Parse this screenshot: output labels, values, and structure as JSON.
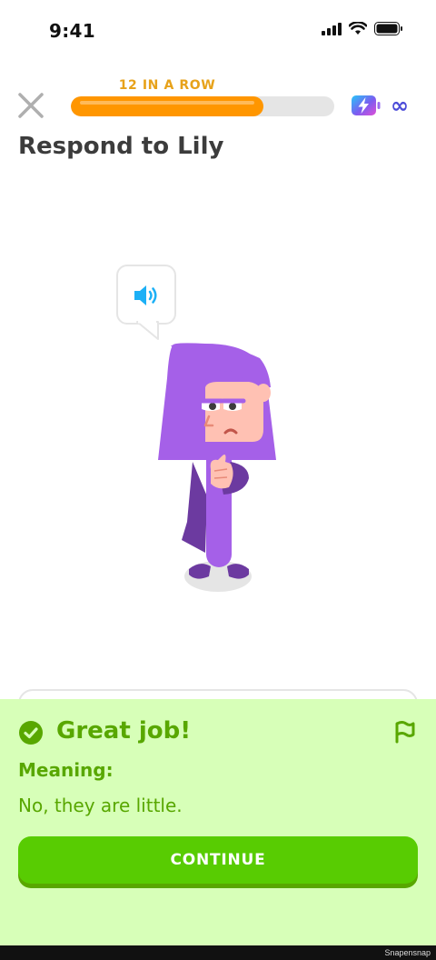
{
  "status_bar": {
    "time": "9:41"
  },
  "header": {
    "streak_label": "12 IN A ROW",
    "progress_fraction": 0.73,
    "energy_value": "∞"
  },
  "prompt": {
    "title": "Respond to Lily"
  },
  "feedback": {
    "title": "Great job!",
    "meaning_label": "Meaning:",
    "meaning_text": "No, they are little.",
    "continue_label": "CONTINUE"
  },
  "footer": {
    "watermark": "Snapensnap"
  },
  "colors": {
    "progress_fill": "#ff9600",
    "streak_text": "#e7a21a",
    "success_green": "#58a700",
    "button_green": "#58cc02",
    "feedback_bg": "#d7ffb8",
    "character_hair": "#a560e8"
  },
  "icons": {
    "close": "close-icon",
    "energy": "battery-lightning-icon",
    "speaker": "speaker-icon",
    "check": "check-circle-icon",
    "flag": "flag-icon"
  }
}
